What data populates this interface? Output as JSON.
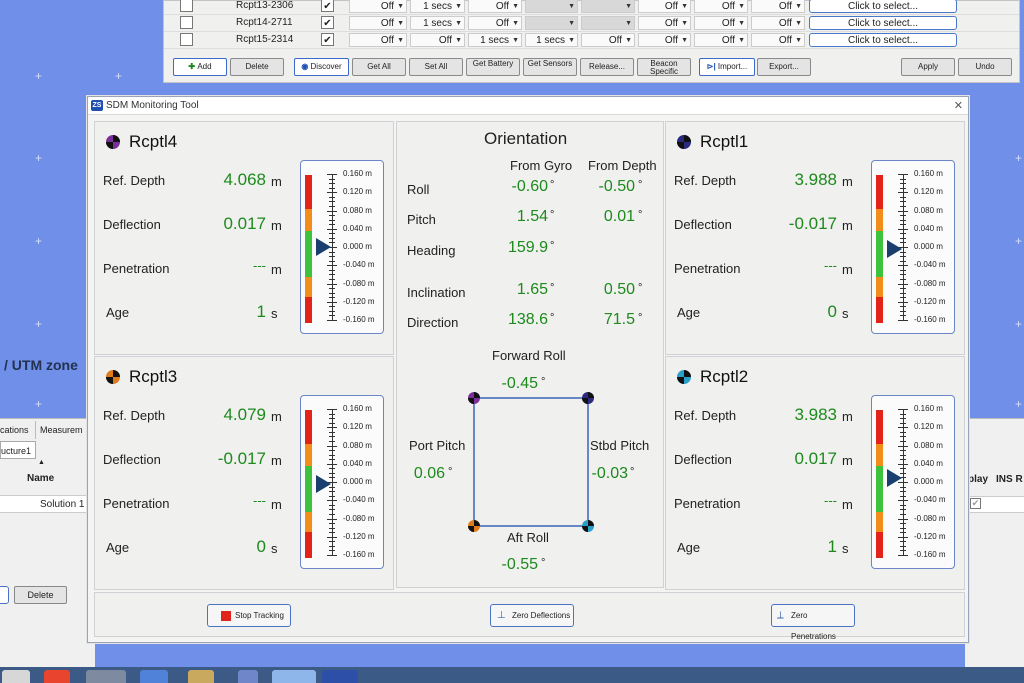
{
  "background": {
    "rows": [
      {
        "name": "Rcpt13-2306",
        "checked": true,
        "c1": "Off",
        "c2": "1 secs",
        "c3": "Off",
        "c4": "",
        "c5": "",
        "c6": "Off",
        "c7": "Off",
        "c8": "Off",
        "select": "Click to select..."
      },
      {
        "name": "Rcpt14-2711",
        "checked": true,
        "c1": "Off",
        "c2": "1 secs",
        "c3": "Off",
        "c4": "",
        "c5": "",
        "c6": "Off",
        "c7": "Off",
        "c8": "Off",
        "select": "Click to select..."
      },
      {
        "name": "Rcpt15-2314",
        "checked": true,
        "c1": "Off",
        "c2": "Off",
        "c3": "1 secs",
        "c4": "1 secs",
        "c5": "Off",
        "c6": "Off",
        "c7": "Off",
        "c8": "Off",
        "select": "Click to select..."
      }
    ],
    "toolbar": {
      "add": "Add",
      "delete": "Delete",
      "discover": "Discover",
      "get_all": "Get All",
      "set_all": "Set All",
      "get_battery": "Get Battery",
      "get_sensors": "Get Sensors",
      "release": "Release...",
      "beacon_specific": "Beacon Specific",
      "import": "Import...",
      "export": "Export...",
      "apply": "Apply",
      "undo": "Undo"
    },
    "left_panel": {
      "utm_text": "/ UTM zone",
      "tab_1": "cations",
      "tab_2": "Measurem",
      "tab_structure": "ucture1",
      "col_name": "Name",
      "row_solution": "Solution 1",
      "delete": "Delete"
    },
    "right_panel": {
      "col_play": "play",
      "col_ins": "INS R"
    }
  },
  "window": {
    "title": "SDM Monitoring Tool",
    "icon_text": "ZS"
  },
  "labels": {
    "ref_depth": "Ref. Depth",
    "deflection": "Deflection",
    "penetration": "Penetration",
    "age": "Age",
    "unit_m": "m",
    "unit_s": "s",
    "deg": "°"
  },
  "gauge_ticks": [
    "0.160 m",
    "0.120 m",
    "0.080 m",
    "0.040 m",
    "0.000 m",
    "-0.040 m",
    "-0.080 m",
    "-0.120 m",
    "-0.160 m"
  ],
  "receptors": [
    {
      "id": "rcptl4",
      "name": "Rcptl4",
      "color": "#7a2f9a",
      "ref_depth": "4.068",
      "deflection": "0.017",
      "penetration": "---",
      "age": "1",
      "pointer_value": 0.0
    },
    {
      "id": "rcptl1",
      "name": "Rcptl1",
      "color": "#2a2a80",
      "ref_depth": "3.988",
      "deflection": "-0.017",
      "penetration": "---",
      "age": "0",
      "pointer_value": -0.005
    },
    {
      "id": "rcptl3",
      "name": "Rcptl3",
      "color": "#e07a1b",
      "ref_depth": "4.079",
      "deflection": "-0.017",
      "penetration": "---",
      "age": "0",
      "pointer_value": -0.005
    },
    {
      "id": "rcptl2",
      "name": "Rcptl2",
      "color": "#2aa0c8",
      "ref_depth": "3.983",
      "deflection": "0.017",
      "penetration": "---",
      "age": "1",
      "pointer_value": 0.008
    }
  ],
  "orientation": {
    "title": "Orientation",
    "col_gyro": "From Gyro",
    "col_depth": "From Depth",
    "roll": {
      "label": "Roll",
      "gyro": "-0.60",
      "depth": "-0.50"
    },
    "pitch": {
      "label": "Pitch",
      "gyro": "1.54",
      "depth": "0.01"
    },
    "heading": {
      "label": "Heading",
      "gyro": "159.9"
    },
    "inclination": {
      "label": "Inclination",
      "gyro": "1.65",
      "depth": "0.50"
    },
    "direction": {
      "label": "Direction",
      "gyro": "138.6",
      "depth": "71.5"
    },
    "forward_roll": {
      "label": "Forward Roll",
      "value": "-0.45"
    },
    "aft_roll": {
      "label": "Aft Roll",
      "value": "-0.55"
    },
    "port_pitch": {
      "label": "Port Pitch",
      "value": "0.06"
    },
    "stbd_pitch": {
      "label": "Stbd Pitch",
      "value": "-0.03"
    }
  },
  "footer": {
    "stop_tracking": "Stop Tracking",
    "zero_deflections": "Zero Deflections",
    "zero_penetrations": "Zero Penetrations"
  },
  "colors": {
    "value_green": "#1d8a1d",
    "accent_blue": "#4c72c6",
    "gauge_red": "#e2231a",
    "gauge_orange": "#f28c1b",
    "gauge_green": "#3cc23c"
  }
}
